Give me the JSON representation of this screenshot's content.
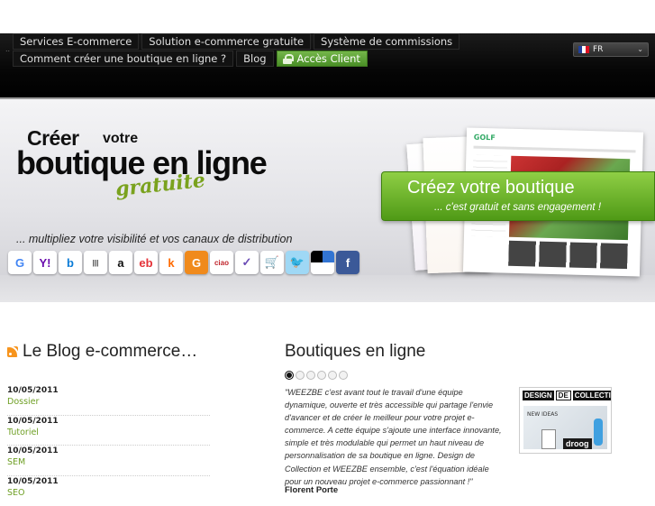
{
  "nav": {
    "row1": [
      "Services E-commerce",
      "Solution e-commerce gratuite",
      "Système de commissions"
    ],
    "row2": [
      "Comment créer une boutique en ligne ?",
      "Blog"
    ],
    "client": "Accès Client",
    "dot": ".."
  },
  "lang": {
    "code": "FR",
    "chevron": "⌄"
  },
  "banner": {
    "creer": "Créer",
    "votre": "votre",
    "boutique": "boutique en ligne",
    "gratuite": "gratuite",
    "multiply": "... multipliez votre visibilité et vos canaux de distribution",
    "shop_logo": "GOLF",
    "cta_main": "Créez votre boutique",
    "cta_sub": "... c'est gratuit et sans engagement !"
  },
  "icons": [
    {
      "name": "google-icon",
      "glyph": "G",
      "bg": "#ffffff",
      "color": "#4285f4"
    },
    {
      "name": "yahoo-icon",
      "glyph": "Y!",
      "bg": "#ffffff",
      "color": "#6a0dad"
    },
    {
      "name": "bing-icon",
      "glyph": "b",
      "bg": "#ffffff",
      "color": "#0a7bd6"
    },
    {
      "name": "barcode-icon",
      "glyph": "|||",
      "bg": "#ffffff",
      "color": "#333333"
    },
    {
      "name": "amazon-icon",
      "glyph": "a",
      "bg": "#ffffff",
      "color": "#111111"
    },
    {
      "name": "ebay-icon",
      "glyph": "eb",
      "bg": "#ffffff",
      "color": "#e53238"
    },
    {
      "name": "kelkoo-icon",
      "glyph": "k",
      "bg": "#ffffff",
      "color": "#ff6a00"
    },
    {
      "name": "g-orange-icon",
      "glyph": "G",
      "bg": "#f08a1c",
      "color": "#ffffff"
    },
    {
      "name": "ciao-icon",
      "glyph": "ciao",
      "bg": "#ffffff",
      "color": "#c0262c"
    },
    {
      "name": "checklist-icon",
      "glyph": "✓",
      "bg": "#ffffff",
      "color": "#6a4bb5"
    },
    {
      "name": "cart-icon",
      "glyph": "🛒",
      "bg": "#ffffff",
      "color": "#40a040"
    },
    {
      "name": "twitter-icon",
      "glyph": "🐦",
      "bg": "#9fd8f5",
      "color": "#ffffff"
    },
    {
      "name": "delicious-icon",
      "glyph": "",
      "bg": "#ffffff",
      "color": "#000000"
    },
    {
      "name": "facebook-icon",
      "glyph": "f",
      "bg": "#3b5998",
      "color": "#ffffff"
    }
  ],
  "blog": {
    "title": "Le Blog e-commerce…",
    "items": [
      {
        "date": "10/05/2011",
        "cat": "Dossier"
      },
      {
        "date": "10/05/2011",
        "cat": "Tutoriel"
      },
      {
        "date": "10/05/2011",
        "cat": "SEM"
      },
      {
        "date": "10/05/2011",
        "cat": "SEO"
      }
    ]
  },
  "boutiques": {
    "title": "Boutiques en ligne",
    "quote": "\"WEEZBE c'est avant tout le travail d'une équipe dynamique, ouverte et très accessible qui partage l'envie d'avancer et de créer le meilleur pour votre projet e-commerce. A cette équipe s'ajoute une interface innovante, simple et très modulable qui permet un haut niveau de personnalisation de sa boutique en ligne. Design de Collection et WEEZBE ensemble, c'est l'équation idéale pour un nouveau projet e-commerce passionnant !\"",
    "author": "Florent Porte",
    "thumb_design": "DESIGN",
    "thumb_de": "DE",
    "thumb_collection": "COLLECTION",
    "thumb_brand": "droog",
    "thumb_small": "NEW IDEAS"
  }
}
